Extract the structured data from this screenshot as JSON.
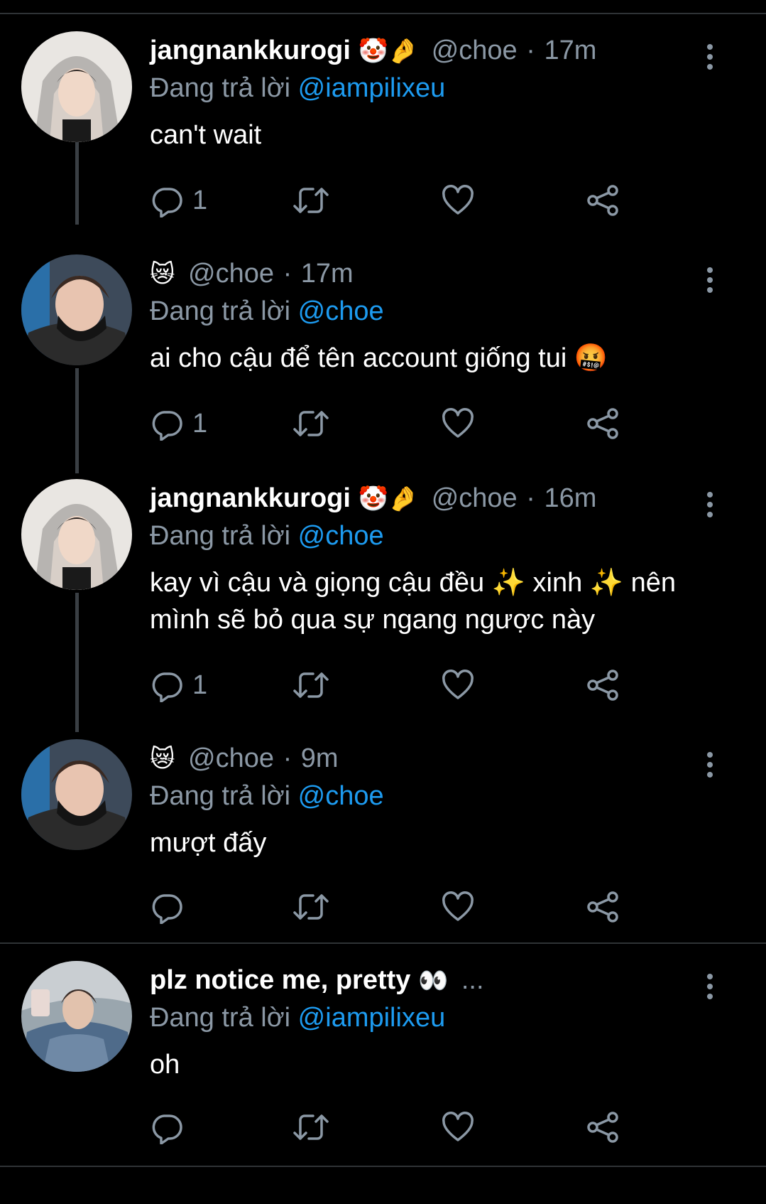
{
  "tweets": [
    {
      "name": "jangnankkurogi",
      "name_emoji": "🤡🤌",
      "handle": "@choe",
      "sep": "·",
      "time": "17m",
      "reply_prefix": "Đang trả lời",
      "reply_to": "@iampilixeu",
      "text": "can't wait",
      "reply_count": "1",
      "avatar": "boy-grey-hoodie"
    },
    {
      "name": "",
      "name_emoji": "😿",
      "handle": "@choe",
      "sep": "·",
      "time": "17m",
      "reply_prefix": "Đang trả lời",
      "reply_to": "@choe",
      "text": "ai cho cậu để tên account giống tui 🤬",
      "reply_count": "1",
      "avatar": "boy-black-mask"
    },
    {
      "name": "jangnankkurogi",
      "name_emoji": "🤡🤌",
      "handle": "@choe",
      "sep": "·",
      "time": "16m",
      "reply_prefix": "Đang trả lời",
      "reply_to": "@choe",
      "text": "kay vì cậu và giọng cậu đều ✨ xinh ✨ nên mình sẽ bỏ qua sự ngang ngược này",
      "reply_count": "1",
      "avatar": "boy-grey-hoodie"
    },
    {
      "name": "",
      "name_emoji": "😿",
      "handle": "@choe",
      "sep": "·",
      "time": "9m",
      "reply_prefix": "Đang trả lời",
      "reply_to": "@choe",
      "text": "mượt đấy",
      "reply_count": "",
      "avatar": "boy-black-mask"
    },
    {
      "name": "plz notice me, pretty",
      "name_emoji": "👀",
      "handle": "...",
      "sep": "",
      "time": "",
      "reply_prefix": "Đang trả lời",
      "reply_to": "@iampilixeu",
      "text": "oh",
      "reply_count": "",
      "avatar": "boy-denim-jacket"
    }
  ],
  "icons": {
    "reply": "reply-icon",
    "retweet": "retweet-icon",
    "like": "heart-icon",
    "share": "share-icon",
    "more": "more-icon"
  },
  "colors": {
    "background": "#000000",
    "text": "#ffffff",
    "muted": "#8b98a5",
    "mention": "#1d9bf0",
    "divider": "#2f3336",
    "thread_line": "#3a3f44"
  }
}
